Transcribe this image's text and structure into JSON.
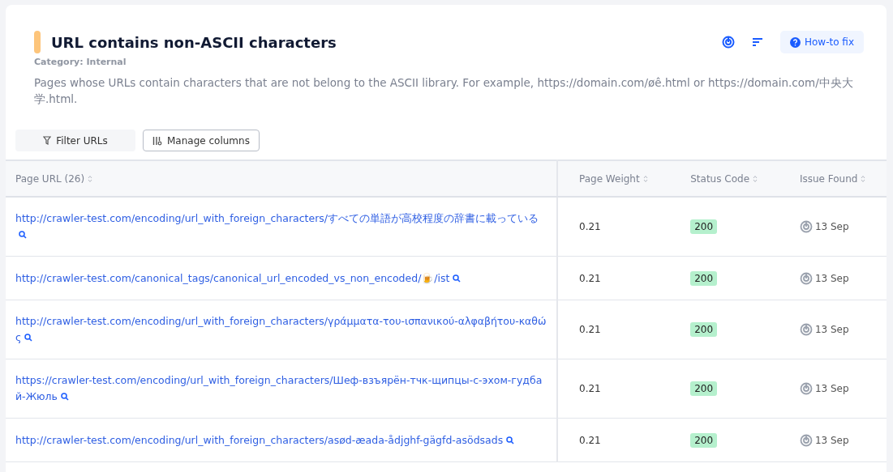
{
  "header": {
    "title": "URL contains non-ASCII characters",
    "category": "Category: Internal",
    "description": "Pages whose URLs contain characters that are not belong to the ASCII library. For example, https://domain.com/øê.html or https://domain.com/中央大学.html.",
    "how_to_fix": "How-to fix"
  },
  "toolbar": {
    "filter": "Filter URLs",
    "manage": "Manage columns"
  },
  "table": {
    "columns": [
      "Page URL (26)",
      "Page Weight",
      "Status Code",
      "Issue Found"
    ],
    "rows": [
      {
        "url": "http://crawler-test.com/encoding/url_with_foreign_characters/すべての単語が高校程度の辞書に載っている",
        "weight": "0.21",
        "status": "200",
        "found": "13 Sep"
      },
      {
        "url": "http://crawler-test.com/canonical_tags/canonical_url_encoded_vs_non_encoded/🍺/ist",
        "weight": "0.21",
        "status": "200",
        "found": "13 Sep"
      },
      {
        "url": "http://crawler-test.com/encoding/url_with_foreign_characters/γράμματα-του-ισπανικού-αλφαβήτου-καθώς",
        "weight": "0.21",
        "status": "200",
        "found": "13 Sep"
      },
      {
        "url": "https://crawler-test.com/encoding/url_with_foreign_characters/Шеф-взъярён-тчк-щипцы-с-эхом-гудбай-Жюль",
        "weight": "0.21",
        "status": "200",
        "found": "13 Sep"
      },
      {
        "url": "http://crawler-test.com/encoding/url_with_foreign_characters/asød-æada-ådjghf-gägfd-asödsads",
        "weight": "0.21",
        "status": "200",
        "found": "13 Sep"
      }
    ]
  }
}
